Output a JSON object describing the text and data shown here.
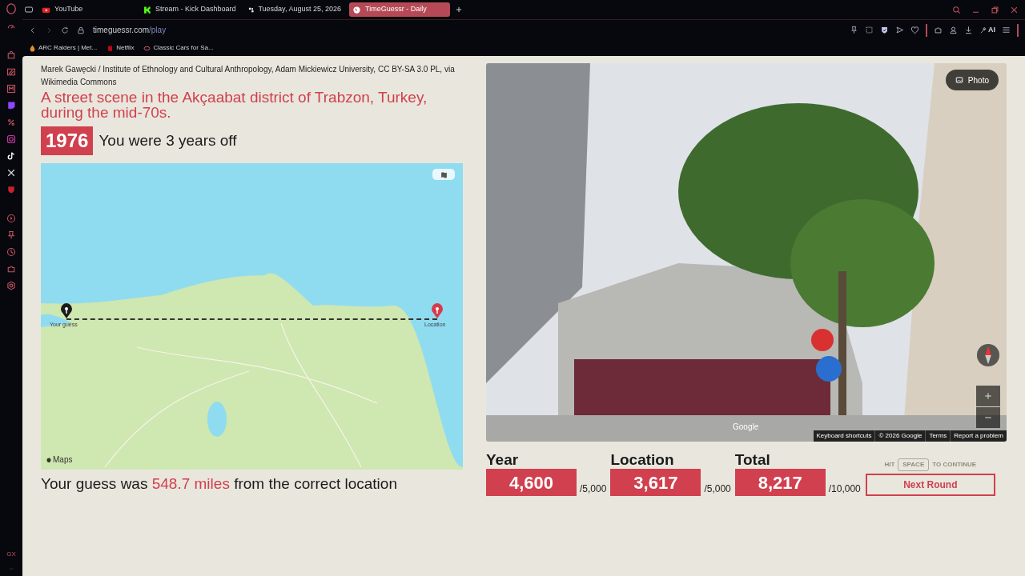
{
  "browser": {
    "tabs": [
      {
        "label": "YouTube",
        "selected": false
      },
      {
        "label": "Stream - Kick Dashboard",
        "selected": false
      },
      {
        "label": "Tuesday, August 25, 2026",
        "selected": false
      },
      {
        "label": "TimeGuessr - Daily",
        "selected": true
      }
    ],
    "url": {
      "host": "timeguessr.com",
      "path": "/play"
    },
    "bookmarks": [
      "ARC Raiders | Met...",
      "Netflix",
      "Classic Cars for Sa..."
    ],
    "ai_label": "AI",
    "sidebar_footer": "GX"
  },
  "round": {
    "credit": "Marek Gawęcki / Institute of Ethnology and Cultural Anthropology, Adam Mickiewicz University, CC BY-SA 3.0 PL, via Wikimedia Commons",
    "description": "A street scene in the Akçaabat district of Trabzon, Turkey, during the mid-70s.",
    "year": "1976",
    "year_result": "You were 3 years off",
    "map": {
      "guess_label": "Your guess",
      "location_label": "Location",
      "attribution": "Maps"
    },
    "distance_prefix": "Your guess was",
    "distance": "548.7 miles",
    "distance_suffix": "from the correct location"
  },
  "streetview": {
    "photo_button": "Photo",
    "logo": "Google",
    "footer": [
      "Keyboard shortcuts",
      "© 2026 Google",
      "Terms",
      "Report a problem"
    ]
  },
  "scores": [
    {
      "label": "Year",
      "value": "4,600",
      "max": "/5,000"
    },
    {
      "label": "Location",
      "value": "3,617",
      "max": "/5,000"
    },
    {
      "label": "Total",
      "value": "8,217",
      "max": "/10,000"
    }
  ],
  "continue_hint": {
    "before": "HIT",
    "key": "SPACE",
    "after": "TO CONTINUE"
  },
  "next_button": "Next Round"
}
